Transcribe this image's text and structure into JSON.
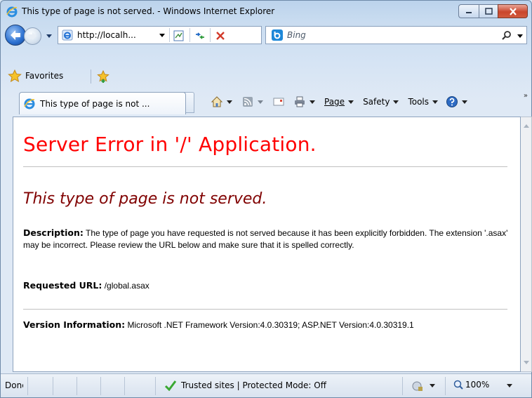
{
  "window": {
    "title": "This type of page is not served. - Windows Internet Explorer"
  },
  "address_bar": {
    "url": "http://localh...",
    "icons": [
      "ie-page-icon",
      "compatibility-view-icon",
      "refresh-icon",
      "stop-icon"
    ]
  },
  "search": {
    "placeholder": "Bing",
    "provider_icon": "bing-icon"
  },
  "favorites_bar": {
    "favorites_label": "Favorites"
  },
  "tab": {
    "label": "This type of page is not ..."
  },
  "command_bar": {
    "page_label": "Page",
    "safety_label": "Safety",
    "tools_label": "Tools",
    "overflow": "»"
  },
  "page": {
    "heading": "Server Error in '/' Application.",
    "subheading": "This type of page is not served.",
    "description_label": "Description:",
    "description_text": "The type of page you have requested is not served because it has been explicitly forbidden.  The extension '.asax' may be incorrect.   Please review the URL below and make sure that it is spelled correctly.",
    "requested_url_label": "Requested URL:",
    "requested_url": "/global.asax",
    "version_label": "Version Information:",
    "version_text": "Microsoft .NET Framework Version:4.0.30319; ASP.NET Version:4.0.30319.1"
  },
  "status_bar": {
    "status": "Done",
    "zone": "Trusted sites | Protected Mode: Off",
    "zoom": "100%"
  },
  "colors": {
    "error_heading": "#ff0000",
    "error_subheading": "#800000",
    "trusted_check": "#3aa832"
  }
}
